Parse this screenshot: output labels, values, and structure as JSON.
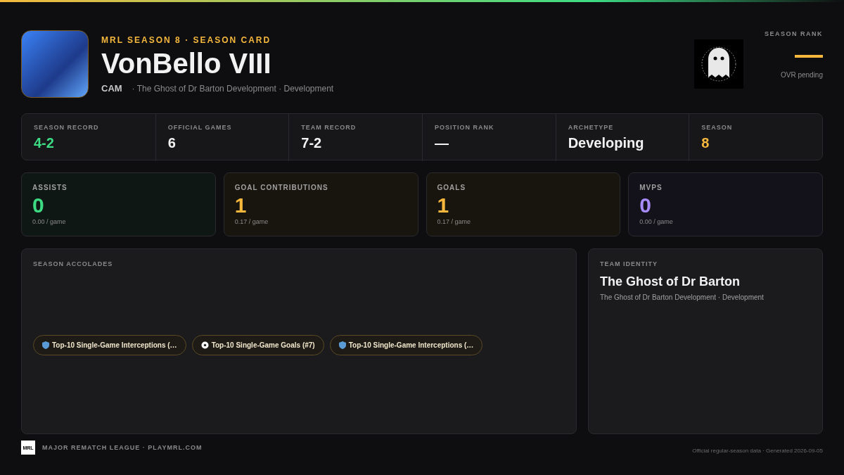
{
  "header": {
    "eyebrow": "MRL SEASON 8 · SEASON CARD",
    "player_name": "VonBello VIII",
    "position": "CAM",
    "team_line": "· The Ghost of Dr Barton Development · Development"
  },
  "season_rank": {
    "label": "SEASON RANK",
    "value": "—",
    "note": "OVR pending"
  },
  "summary": [
    {
      "label": "SEASON RECORD",
      "value": "4-2",
      "color": "#3ddc84"
    },
    {
      "label": "OFFICIAL GAMES",
      "value": "6",
      "color": "#f2f2f2"
    },
    {
      "label": "TEAM RECORD",
      "value": "7-2",
      "color": "#f2f2f2"
    },
    {
      "label": "POSITION RANK",
      "value": "—",
      "color": "#f2f2f2"
    },
    {
      "label": "ARCHETYPE",
      "value": "Developing",
      "color": "#f2f2f2"
    },
    {
      "label": "SEASON",
      "value": "8",
      "color": "#f5b83d"
    }
  ],
  "stat_cards": [
    {
      "label": "ASSISTS",
      "value": "0",
      "per_game": "0.00 / game",
      "color": "#3ddc84"
    },
    {
      "label": "GOAL CONTRIBUTIONS",
      "value": "1",
      "per_game": "0.17 / game",
      "color": "#f5b83d"
    },
    {
      "label": "GOALS",
      "value": "1",
      "per_game": "0.17 / game",
      "color": "#f5b83d"
    },
    {
      "label": "MVPS",
      "value": "0",
      "per_game": "0.00 / game",
      "color": "#a78bfa"
    }
  ],
  "accolades": {
    "title": "SEASON ACCOLADES",
    "items": [
      {
        "kind": "shield",
        "label": "Top-10 Single-Game Interceptions (…"
      },
      {
        "kind": "ball",
        "label": "Top-10 Single-Game Goals (#7)"
      },
      {
        "kind": "shield",
        "label": "Top-10 Single-Game Interceptions (…"
      }
    ]
  },
  "team_identity": {
    "title": "TEAM IDENTITY",
    "name": "The Ghost of Dr Barton",
    "subtitle": "The Ghost of Dr Barton Development · Development"
  },
  "footer": {
    "logo_text": "MRL",
    "league": "MAJOR REMATCH LEAGUE · PLAYMRL.COM",
    "note": "Official regular-season data · Generated 2026-09-05"
  }
}
